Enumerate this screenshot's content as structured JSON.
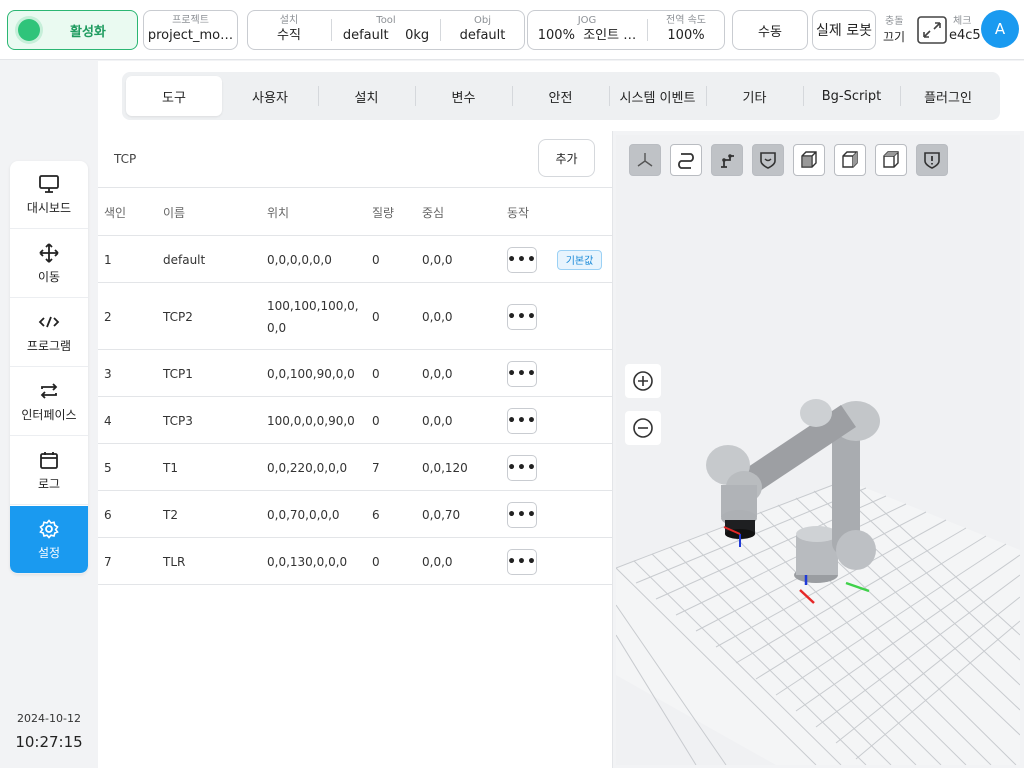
{
  "header": {
    "activate_label": "활성화",
    "project": {
      "label": "프로젝트",
      "value": "project_mo…"
    },
    "install": {
      "label": "설치",
      "value": "수직"
    },
    "tool": {
      "label": "Tool",
      "value": "default",
      "extra": "0kg"
    },
    "obj": {
      "label": "Obj",
      "value": "default"
    },
    "jog": {
      "label": "JOG",
      "percent": "100%",
      "value": "조인트 …"
    },
    "global_speed": {
      "label": "전역 속도",
      "value": "100%"
    },
    "manual_label": "수동",
    "real_robot_label": "실제 로봇",
    "collision": {
      "label": "충돌",
      "value": "끄기"
    },
    "check": {
      "label": "체크",
      "value": "e4c5"
    },
    "avatar": "A"
  },
  "tabs": [
    "도구",
    "사용자",
    "설치",
    "변수",
    "안전",
    "시스템 이벤트",
    "기타",
    "Bg-Script",
    "플러그인"
  ],
  "active_tab": "도구",
  "nav": [
    {
      "label": "대시보드",
      "icon": "monitor-icon"
    },
    {
      "label": "이동",
      "icon": "move-icon"
    },
    {
      "label": "프로그램",
      "icon": "code-icon"
    },
    {
      "label": "인터페이스",
      "icon": "swap-icon"
    },
    {
      "label": "로그",
      "icon": "calendar-icon"
    },
    {
      "label": "설정",
      "icon": "gear-icon"
    }
  ],
  "active_nav": "설정",
  "clock": {
    "date": "2024-10-12",
    "time": "10:27:15"
  },
  "tcp": {
    "title": "TCP",
    "add_label": "추가",
    "columns": [
      "색인",
      "이름",
      "위치",
      "질량",
      "중심",
      "동작"
    ],
    "default_badge": "기본값",
    "rows": [
      {
        "index": "1",
        "name": "default",
        "position": "0,0,0,0,0,0",
        "mass": "0",
        "center": "0,0,0",
        "is_default": true
      },
      {
        "index": "2",
        "name": "TCP2",
        "position": "100,100,100,0,\n0,0",
        "mass": "0",
        "center": "0,0,0",
        "is_default": false
      },
      {
        "index": "3",
        "name": "TCP1",
        "position": "0,0,100,90,0,0",
        "mass": "0",
        "center": "0,0,0",
        "is_default": false
      },
      {
        "index": "4",
        "name": "TCP3",
        "position": "100,0,0,0,90,0",
        "mass": "0",
        "center": "0,0,0",
        "is_default": false
      },
      {
        "index": "5",
        "name": "T1",
        "position": "0,0,220,0,0,0",
        "mass": "7",
        "center": "0,0,120",
        "is_default": false
      },
      {
        "index": "6",
        "name": "T2",
        "position": "0,0,70,0,0,0",
        "mass": "6",
        "center": "0,0,70",
        "is_default": false
      },
      {
        "index": "7",
        "name": "TLR",
        "position": "0,0,130,0,0,0",
        "mass": "0",
        "center": "0,0,0",
        "is_default": false
      }
    ],
    "more_symbol": "•••"
  },
  "view_tools": [
    "axes-icon",
    "path-icon",
    "robot-icon",
    "shield-icon",
    "cube-front-icon",
    "cube-side-icon",
    "cube-top-icon",
    "warning-shield-icon"
  ],
  "zoom": {
    "in": "zoom-in-icon",
    "out": "zoom-out-icon"
  },
  "colors": {
    "accent": "#1a9af0",
    "active_green": "#2fc47a",
    "badge": "#1a8ad8"
  }
}
